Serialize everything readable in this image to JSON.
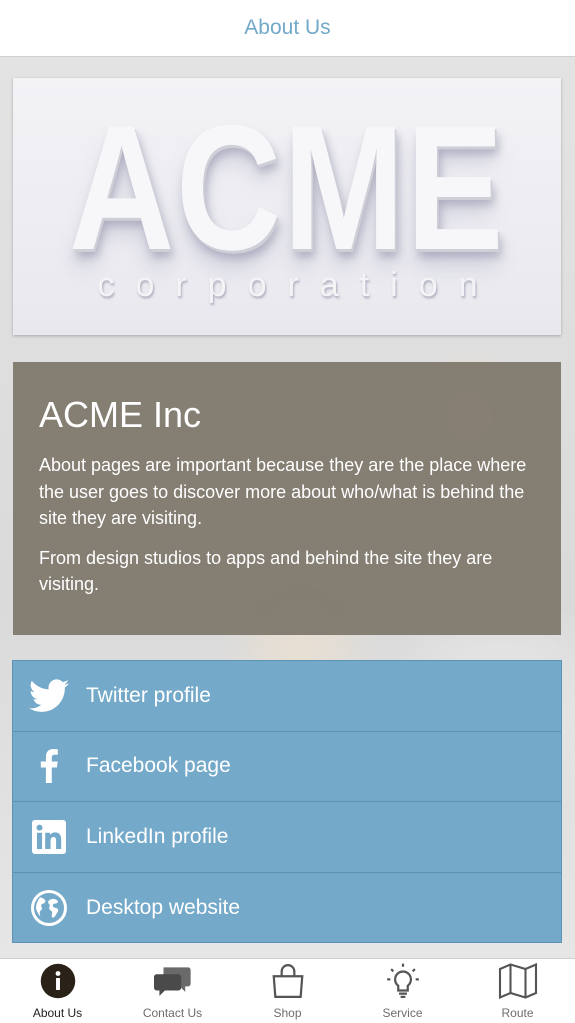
{
  "header": {
    "title": "About Us"
  },
  "hero": {
    "logo_text": "ACME",
    "logo_subtext": "corporation"
  },
  "info": {
    "title": "ACME Inc",
    "paragraphs": [
      "About pages are important because they are the place where the user goes to discover more about who/what is behind the site they are visiting.",
      "From design studios to apps and behind the site they are visiting."
    ]
  },
  "links": [
    {
      "label": "Twitter profile",
      "icon": "twitter-icon"
    },
    {
      "label": "Facebook page",
      "icon": "facebook-icon"
    },
    {
      "label": "LinkedIn profile",
      "icon": "linkedin-icon"
    },
    {
      "label": "Desktop website",
      "icon": "globe-icon"
    }
  ],
  "tabs": [
    {
      "label": "About Us",
      "icon": "info-icon",
      "active": true
    },
    {
      "label": "Contact Us",
      "icon": "chat-icon",
      "active": false
    },
    {
      "label": "Shop",
      "icon": "shopping-bag-icon",
      "active": false
    },
    {
      "label": "Service",
      "icon": "lightbulb-icon",
      "active": false
    },
    {
      "label": "Route",
      "icon": "map-icon",
      "active": false
    }
  ],
  "colors": {
    "accent": "#74a9c9",
    "header_text": "#72a9c9",
    "info_bg": "#787164",
    "tab_icon": "#555555"
  }
}
